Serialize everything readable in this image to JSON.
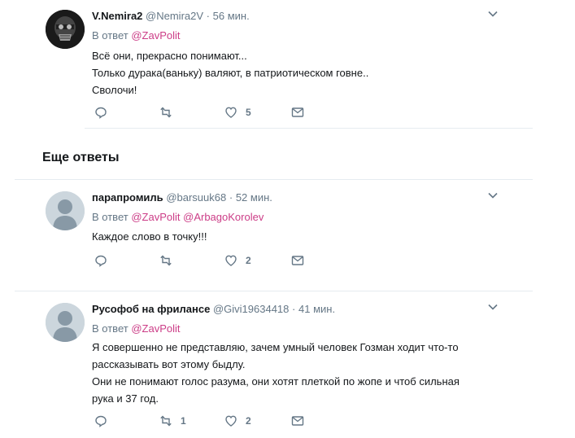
{
  "tweets": [
    {
      "name": "V.Nemira2",
      "handle": "@Nemira2V",
      "dot": "·",
      "time": "56 мин.",
      "reply_prefix": "В ответ",
      "mentions": [
        "@ZavPolit"
      ],
      "lines": [
        "Всё они, прекрасно понимают...",
        "Только дурака(ваньку) валяют, в патриотическом говне..",
        "Сволочи!"
      ],
      "replies_count": "",
      "retweets_count": "",
      "likes_count": "5"
    },
    {
      "name": "парапромиль",
      "handle": "@barsuuk68",
      "dot": "·",
      "time": "52 мин.",
      "reply_prefix": "В ответ",
      "mentions": [
        "@ZavPolit",
        "@ArbagoKorolev"
      ],
      "lines": [
        "Каждое слово в точку!!!"
      ],
      "replies_count": "",
      "retweets_count": "",
      "likes_count": "2"
    },
    {
      "name": "Русофоб на фрилансе",
      "handle": "@Givi19634418",
      "dot": "·",
      "time": "41 мин.",
      "reply_prefix": "В ответ",
      "mentions": [
        "@ZavPolit"
      ],
      "lines": [
        "Я совершенно не представляю, зачем умный человек Гозман ходит что-то",
        "рассказывать вот этому быдлу.",
        "Они не понимают голос разума, они хотят плеткой по жопе и чтоб сильная",
        "рука и 37 год."
      ],
      "replies_count": "",
      "retweets_count": "1",
      "likes_count": "2"
    }
  ],
  "section_title": "Еще ответы",
  "colors": {
    "mention": "#cc3d87",
    "secondary": "#657786",
    "divider": "#e6ecf0"
  }
}
